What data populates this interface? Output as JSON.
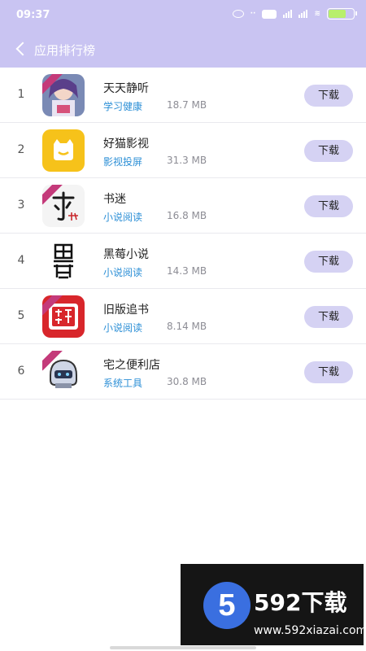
{
  "status_bar": {
    "time": "09:37"
  },
  "nav": {
    "title": "应用排行榜"
  },
  "apps": [
    {
      "rank": "1",
      "name": "天天静听",
      "category": "学习健康",
      "size": "18.7 MB",
      "download_label": "下载"
    },
    {
      "rank": "2",
      "name": "好猫影视",
      "category": "影视投屏",
      "size": "31.3 MB",
      "download_label": "下载"
    },
    {
      "rank": "3",
      "name": "书迷",
      "category": "小说阅读",
      "size": "16.8 MB",
      "download_label": "下载"
    },
    {
      "rank": "4",
      "name": "黑莓小说",
      "category": "小说阅读",
      "size": "14.3 MB",
      "download_label": "下载"
    },
    {
      "rank": "5",
      "name": "旧版追书",
      "category": "小说阅读",
      "size": "8.14 MB",
      "download_label": "下载"
    },
    {
      "rank": "6",
      "name": "宅之便利店",
      "category": "系统工具",
      "size": "30.8 MB",
      "download_label": "下载"
    }
  ],
  "watermark": {
    "logo_char": "5",
    "brand": "592下载",
    "url": "www.592xiazai.com"
  },
  "colors": {
    "header": "#c9c4f2",
    "download_button": "#d5d2f3",
    "category_text": "#2c8fd6"
  }
}
